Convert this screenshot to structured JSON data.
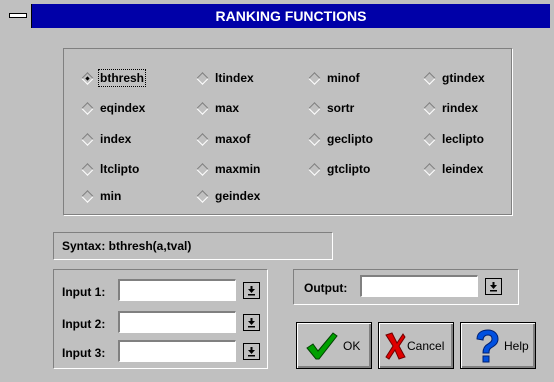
{
  "window": {
    "title": "RANKING FUNCTIONS"
  },
  "functions": [
    {
      "label": "bthresh",
      "selected": true
    },
    {
      "label": "ltindex"
    },
    {
      "label": "minof"
    },
    {
      "label": "gtindex"
    },
    {
      "label": "eqindex"
    },
    {
      "label": "max"
    },
    {
      "label": "sortr"
    },
    {
      "label": "rindex"
    },
    {
      "label": "index"
    },
    {
      "label": "maxof"
    },
    {
      "label": "geclipto"
    },
    {
      "label": "leclipto"
    },
    {
      "label": "ltclipto"
    },
    {
      "label": "maxmin"
    },
    {
      "label": "gtclipto"
    },
    {
      "label": "leindex"
    },
    {
      "label": "min"
    },
    {
      "label": "geindex"
    }
  ],
  "syntax": {
    "text": "Syntax:  bthresh(a,tval)"
  },
  "inputs": [
    {
      "label": "Input 1:",
      "value": ""
    },
    {
      "label": "Input 2:",
      "value": ""
    },
    {
      "label": "Input 3:",
      "value": ""
    }
  ],
  "output": {
    "label": "Output:",
    "value": ""
  },
  "buttons": {
    "ok": "OK",
    "cancel": "Cancel",
    "help": "Help"
  },
  "icons": {
    "system_menu": "minus-bar-icon",
    "dropdown": "down-arrow-bar-icon",
    "ok": "check-icon",
    "cancel": "x-icon",
    "help": "question-icon"
  }
}
